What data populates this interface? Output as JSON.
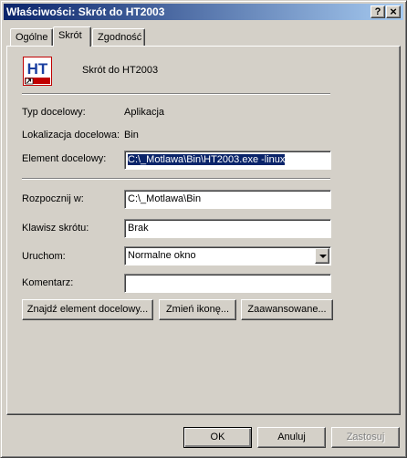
{
  "window": {
    "title": "Właściwości: Skrót do HT2003",
    "help_label": "?",
    "close_label": "×"
  },
  "tabs": [
    {
      "label": "Ogólne"
    },
    {
      "label": "Skrót"
    },
    {
      "label": "Zgodność"
    }
  ],
  "shortcut": {
    "name": "Skrót do HT2003",
    "icon": "ht-app-icon",
    "icon_text": "HT",
    "target_type_label": "Typ docelowy:",
    "target_type_value": "Aplikacja",
    "target_location_label": "Lokalizacja docelowa:",
    "target_location_value": "Bin",
    "target_label": "Element docelowy:",
    "target_value": "C:\\_Motlawa\\Bin\\HT2003.exe -linux",
    "start_in_label": "Rozpocznij w:",
    "start_in_value": "C:\\_Motlawa\\Bin",
    "hotkey_label": "Klawisz skrótu:",
    "hotkey_value": "Brak",
    "run_label": "Uruchom:",
    "run_value": "Normalne okno",
    "comment_label": "Komentarz:",
    "comment_value": ""
  },
  "buttons": {
    "find_target": "Znajdź element docelowy...",
    "change_icon": "Zmień ikonę...",
    "advanced": "Zaawansowane...",
    "ok": "OK",
    "cancel": "Anuluj",
    "apply": "Zastosuj"
  },
  "colors": {
    "titlebar_start": "#0a246a",
    "titlebar_end": "#a6caf0",
    "face": "#d4d0c8",
    "selection": "#0a246a"
  }
}
